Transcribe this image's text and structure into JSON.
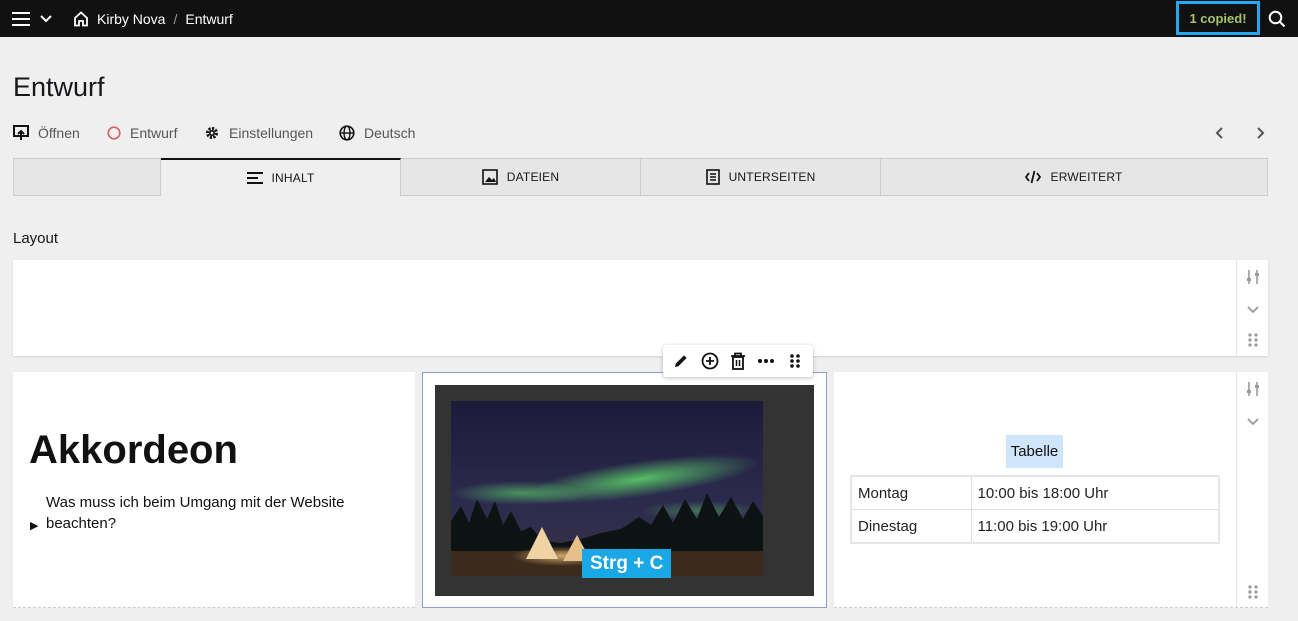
{
  "topbar": {
    "menu_icon": "hamburger-icon",
    "home_icon": "home-icon",
    "breadcrumb": [
      "Kirby Nova",
      "Entwurf"
    ],
    "separator": "/",
    "copied_badge": "1 copied!",
    "search_icon": "search-icon"
  },
  "header": {
    "title": "Entwurf",
    "buttons": [
      {
        "label": "Öffnen",
        "icon": "open-icon"
      },
      {
        "label": "Entwurf",
        "icon": "status-circle-icon"
      },
      {
        "label": "Einstellungen",
        "icon": "gear-icon"
      },
      {
        "label": "Deutsch",
        "icon": "globe-icon"
      }
    ]
  },
  "tabs": [
    {
      "label": "",
      "icon": ""
    },
    {
      "label": "INHALT",
      "icon": "text-lines-icon",
      "active": true
    },
    {
      "label": "DATEIEN",
      "icon": "image-icon"
    },
    {
      "label": "UNTERSEITEN",
      "icon": "pages-icon"
    },
    {
      "label": "ERWEITERT",
      "icon": "code-icon"
    }
  ],
  "section": {
    "label": "Layout"
  },
  "accordion": {
    "title": "Akkordeon",
    "question": "Was muss ich beim Umgang mit der Website beachten?"
  },
  "image_block": {
    "shortcut_label": "Strg + C"
  },
  "table_block": {
    "title": "Tabelle",
    "rows": [
      [
        "Montag",
        "10:00 bis 18:00 Uhr"
      ],
      [
        "Dinestag",
        "11:00 bis 19:00 Uhr"
      ]
    ]
  },
  "colors": {
    "accent": "#1aa7e6",
    "copied_text": "#a3c56a",
    "status_red": "#d16464"
  }
}
